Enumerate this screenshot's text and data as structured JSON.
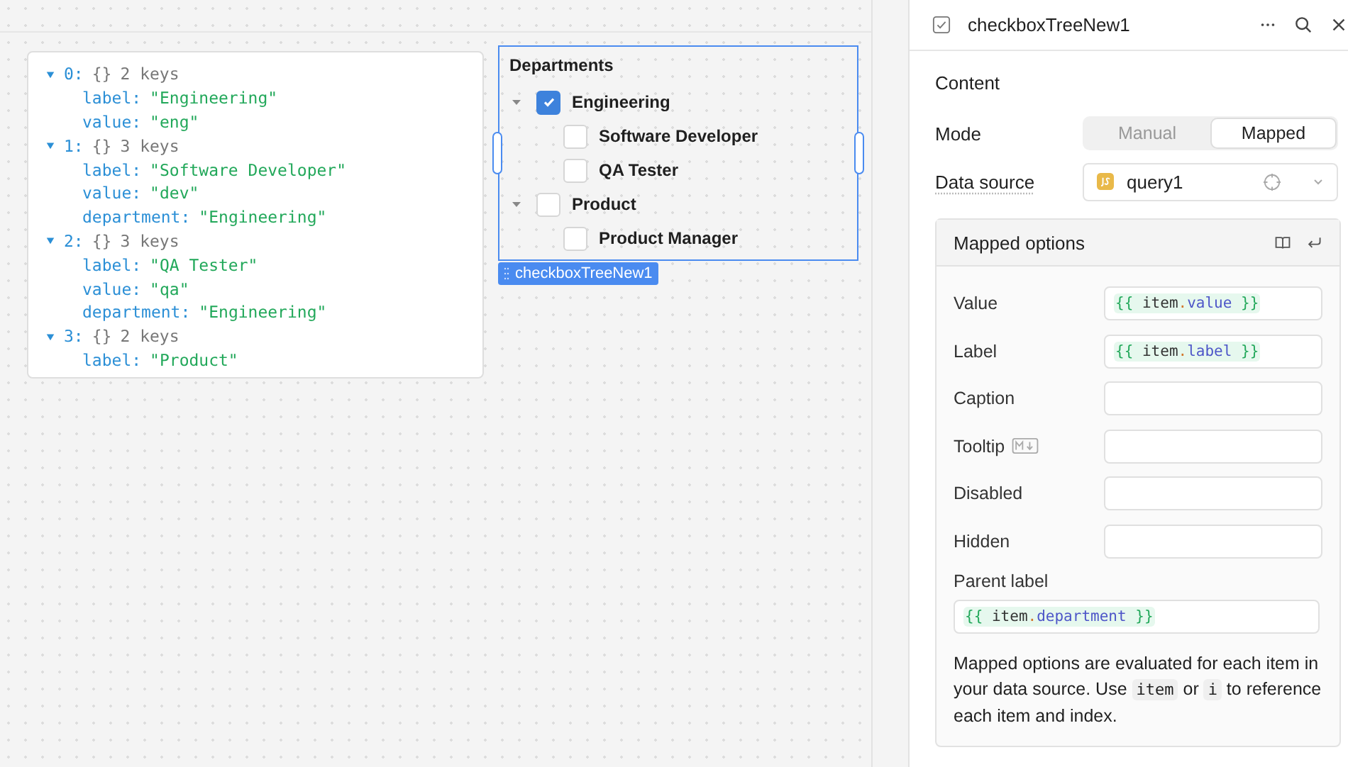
{
  "json_viewer": {
    "entries": [
      {
        "index": "0:",
        "summary": "{}",
        "count": "2 keys",
        "expanded": true,
        "fields": [
          {
            "key": "label:",
            "value": "\"Engineering\""
          },
          {
            "key": "value:",
            "value": "\"eng\""
          }
        ]
      },
      {
        "index": "1:",
        "summary": "{}",
        "count": "3 keys",
        "expanded": true,
        "fields": [
          {
            "key": "label:",
            "value": "\"Software Developer\""
          },
          {
            "key": "value:",
            "value": "\"dev\""
          },
          {
            "key": "department:",
            "value": "\"Engineering\""
          }
        ]
      },
      {
        "index": "2:",
        "summary": "{}",
        "count": "3 keys",
        "expanded": true,
        "fields": [
          {
            "key": "label:",
            "value": "\"QA Tester\""
          },
          {
            "key": "value:",
            "value": "\"qa\""
          },
          {
            "key": "department:",
            "value": "\"Engineering\""
          }
        ]
      },
      {
        "index": "3:",
        "summary": "{}",
        "count": "2 keys",
        "expanded": true,
        "fields": [
          {
            "key": "label:",
            "value": "\"Product\""
          }
        ]
      }
    ]
  },
  "checkbox_tree": {
    "title": "Departments",
    "selected": true,
    "tag": "checkboxTreeNew1",
    "items": [
      {
        "label": "Engineering",
        "checked": true,
        "expanded": true,
        "children": [
          {
            "label": "Software Developer",
            "checked": false
          },
          {
            "label": "QA Tester",
            "checked": false
          }
        ]
      },
      {
        "label": "Product",
        "checked": false,
        "expanded": true,
        "children": [
          {
            "label": "Product Manager",
            "checked": false
          }
        ]
      }
    ]
  },
  "inspector": {
    "title": "checkboxTreeNew1",
    "section": "Content",
    "mode": {
      "label": "Mode",
      "options": [
        {
          "label": "Manual",
          "selected": false
        },
        {
          "label": "Mapped",
          "selected": true
        }
      ]
    },
    "data_source": {
      "label": "Data source",
      "value": "query1"
    },
    "mapped_options": {
      "title": "Mapped options",
      "fields": [
        {
          "label": "Value",
          "markdown": false,
          "value": "{{ item.value }}"
        },
        {
          "label": "Label",
          "markdown": false,
          "value": "{{ item.label }}"
        },
        {
          "label": "Caption",
          "markdown": false
        },
        {
          "label": "Tooltip",
          "markdown": true
        },
        {
          "label": "Disabled",
          "markdown": false
        },
        {
          "label": "Hidden",
          "markdown": false
        }
      ],
      "parent": {
        "label": "Parent label",
        "value": "{{ item.department }}"
      },
      "help": [
        {
          "text": "Mapped options are evaluated for each item in your data source. Use ",
          "kind": "text"
        },
        {
          "text": "item",
          "kind": "code"
        },
        {
          "text": " or ",
          "kind": "text"
        },
        {
          "text": "i",
          "kind": "code"
        },
        {
          "text": " to reference each item and index.",
          "kind": "text"
        }
      ]
    }
  }
}
